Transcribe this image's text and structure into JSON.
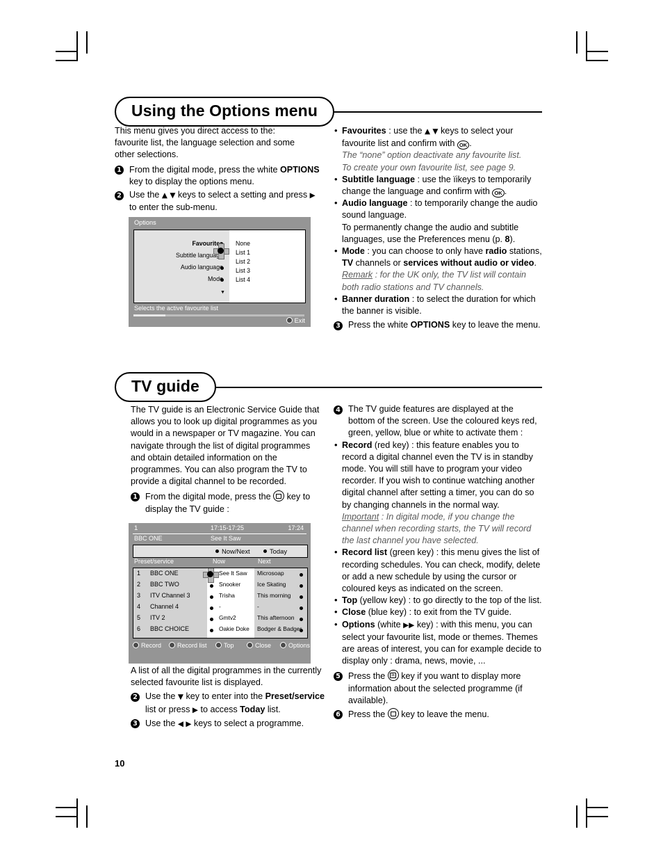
{
  "page_number": "10",
  "sections": {
    "options": {
      "heading": "Using the Options menu",
      "intro": "This menu gives you direct access to the: favourite list, the language selection and some other selections.",
      "steps": [
        {
          "num": "1",
          "html": "From the digital mode, press the white <b>OPTIONS</b> key to display the options menu."
        },
        {
          "num": "2",
          "html": "Use the <span class=\"ar\">▲ ▼</span> keys to select a setting and press <span class=\"ar\">▶</span> to enter the sub-menu."
        }
      ],
      "bullets": [
        {
          "html": "<b>Favourites</b> : use the <span class=\"ar\">▲ ▼</span> keys to select your favourite list and confirm with <span class=\"keyb\">OK</span>."
        },
        {
          "html": "<span class=\"it\">The “none” option deactivate any favourite list.<br>To create your own favourite list, see page 9.</span>",
          "plain": true
        },
        {
          "html": "<b>Subtitle language</b> : use the ïikeys to temporarily change the language and confirm with <span class=\"keyb\">OK</span>."
        },
        {
          "html": "<b>Audio language</b> : to temporarily change the audio sound language."
        },
        {
          "html": "To permanently change the audio and subtitle languages, use the Preferences menu (p. <b>8</b>).",
          "plain": true
        },
        {
          "html": "<b>Mode</b> : you can choose to only have <b>radio</b> stations, <b>TV</b> channels or <b>services without audio or video</b>."
        },
        {
          "html": "<span class=\"it\"><u>Remark</u> : for the UK only, the TV list will contain both radio stations and TV channels.</span>",
          "plain": true
        },
        {
          "html": "<b>Banner duration</b> :  to select the duration for which the banner is visible."
        }
      ],
      "final_step": {
        "num": "3",
        "html": "Press the white <b>OPTIONS</b> key to leave the menu."
      }
    },
    "tvguide": {
      "heading": "TV guide",
      "intro": "The TV guide is an Electronic Service Guide that allows you to look up digital programmes as you would in a newspaper or TV magazine. You can navigate through the list of digital programmes and obtain detailed information on the programmes. You can also program the TV to provide a digital channel to be recorded.",
      "step1": {
        "num": "1",
        "html": "From the digital mode, press the <span class=\"keyg\"></span> key to display the TV guide :"
      },
      "after_shot": "A list of all the digital programmes in the currently selected favourite list is displayed.",
      "steps_left": [
        {
          "num": "2",
          "html": "Use the <span class=\"ar\">▼</span> key to enter into the <b>Preset/service</b> list or press <span class=\"ar\">▶</span> to access <b>Today</b> list."
        },
        {
          "num": "3",
          "html": "Use the <span class=\"ar\">◀ ▶</span> keys to select a programme."
        }
      ],
      "step4": {
        "num": "4",
        "html": "The TV guide features are displayed at the bottom of the screen. Use the coloured keys red, green, yellow, blue or white to activate them :"
      },
      "bullets_right": [
        {
          "html": "<b>Record</b> (red key) : this feature enables you to record a digital channel even the TV is in standby mode. You will still have to program your video recorder. If you wish to continue watching another digital channel after setting a timer, you can do so by changing channels in the normal way."
        },
        {
          "html": "<span class=\"it\"><u>Important</u> : In digital mode, if you change the channel when recording starts, the TV will record the last channel you have selected.</span>",
          "plain": true
        },
        {
          "html": "<b>Record list</b> (green key) : this menu gives the list of recording schedules. You can check, modify, delete or add a new schedule by using the cursor or coloured keys as indicated on the screen."
        },
        {
          "html": "<b>Top</b> (yellow key) : to go directly to the top of the list."
        },
        {
          "html": "<b>Close</b> (blue key) : to exit from the TV guide."
        },
        {
          "html": "<b>Options</b> (white <span class=\"ar\">▶▶</span> key) : with this menu, you can select your favourite list, mode or themes. Themes are areas of interest, you can for example decide to display only : drama, news, movie, ..."
        }
      ],
      "step5": {
        "num": "5",
        "html": "Press the <span class=\"keyi\"></span> key if you want to display more information about the selected programme (if available)."
      },
      "step6": {
        "num": "6",
        "html": "Press the <span class=\"keyg\"></span> key to leave the menu."
      }
    }
  },
  "options_screenshot": {
    "title": "Options",
    "menu_items": [
      {
        "label": "Favourites",
        "selected": true
      },
      {
        "label": "Subtitle language",
        "selected": false
      },
      {
        "label": "Audio language",
        "selected": false
      },
      {
        "label": "Mode",
        "selected": false
      }
    ],
    "values": [
      "None",
      "List 1",
      "List 2",
      "List 3",
      "List 4"
    ],
    "status_text": "Selects the active favourite list",
    "exit_label": "Exit"
  },
  "tvguide_screenshot": {
    "preset_number": "1",
    "time_range": "17:15-17:25",
    "clock": "17:24",
    "channel_name": "BBC ONE",
    "programme_name": "See It Saw",
    "tabs": [
      "Now/Next",
      "Today"
    ],
    "columns": [
      "Preset/service",
      "Now",
      "Next"
    ],
    "rows": [
      {
        "num": "1",
        "name": "BBC ONE",
        "now": "See It Saw",
        "next": "Microsoap",
        "cursor": true
      },
      {
        "num": "2",
        "name": "BBC TWO",
        "now": "Snooker",
        "next": "Ice Skating",
        "cursor": false
      },
      {
        "num": "3",
        "name": "ITV Channel 3",
        "now": "Trisha",
        "next": "This morning",
        "cursor": false
      },
      {
        "num": "4",
        "name": "Channel 4",
        "now": "-",
        "next": "-",
        "cursor": false
      },
      {
        "num": "5",
        "name": "ITV 2",
        "now": "Gmtv2",
        "next": "This afternoon",
        "cursor": false
      },
      {
        "num": "6",
        "name": "BBC CHOICE",
        "now": "Oakie Doke",
        "next": "Bodger & Badger",
        "cursor": false
      }
    ],
    "footer_keys": [
      "Record",
      "Record list",
      "Top",
      "Close",
      "Options"
    ]
  }
}
